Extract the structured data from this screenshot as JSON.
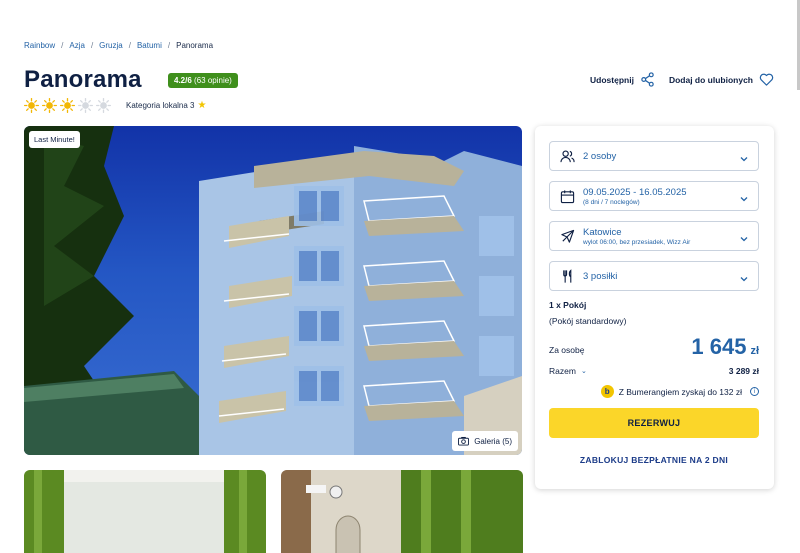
{
  "breadcrumb": {
    "items": [
      "Rainbow",
      "Azja",
      "Gruzja",
      "Batumi"
    ],
    "current": "Panorama"
  },
  "hotel": {
    "name": "Panorama",
    "rating": "4.2/6",
    "reviews": "(63 opinie)",
    "category_label": "Kategoria lokalna 3",
    "rating_suns": 3,
    "rating_suns_max": 5
  },
  "actions": {
    "share": "Udostępnij",
    "favorite": "Dodaj do ulubionych"
  },
  "gallery": {
    "badge": "Last Minute!",
    "button": "Galeria (5)"
  },
  "booking": {
    "persons": "2 osoby",
    "dates": "09.05.2025 - 16.05.2025",
    "dates_sub": "(8 dni / 7 noclegów)",
    "departure": "Katowice",
    "departure_sub": "wylot 06:00, bez przesiadek, Wizz Air",
    "meals": "3 posiłki",
    "room_count": "1 x Pokój",
    "room_type": "(Pokój standardowy)",
    "per_person_label": "Za osobę",
    "price": "1 645",
    "currency": "zł",
    "total_label": "Razem",
    "total": "3 289 zł",
    "bumerang": "Z Bumerangiem zyskaj do 132 zł",
    "book_button": "REZERWUJ",
    "lock_button": "ZABLOKUJ BEZPŁATNIE NA 2 DNI"
  },
  "colors": {
    "accent": "#2463a6",
    "rating_badge": "#3f8f1c",
    "book_button": "#fbd629",
    "sun": "#f2b705"
  }
}
